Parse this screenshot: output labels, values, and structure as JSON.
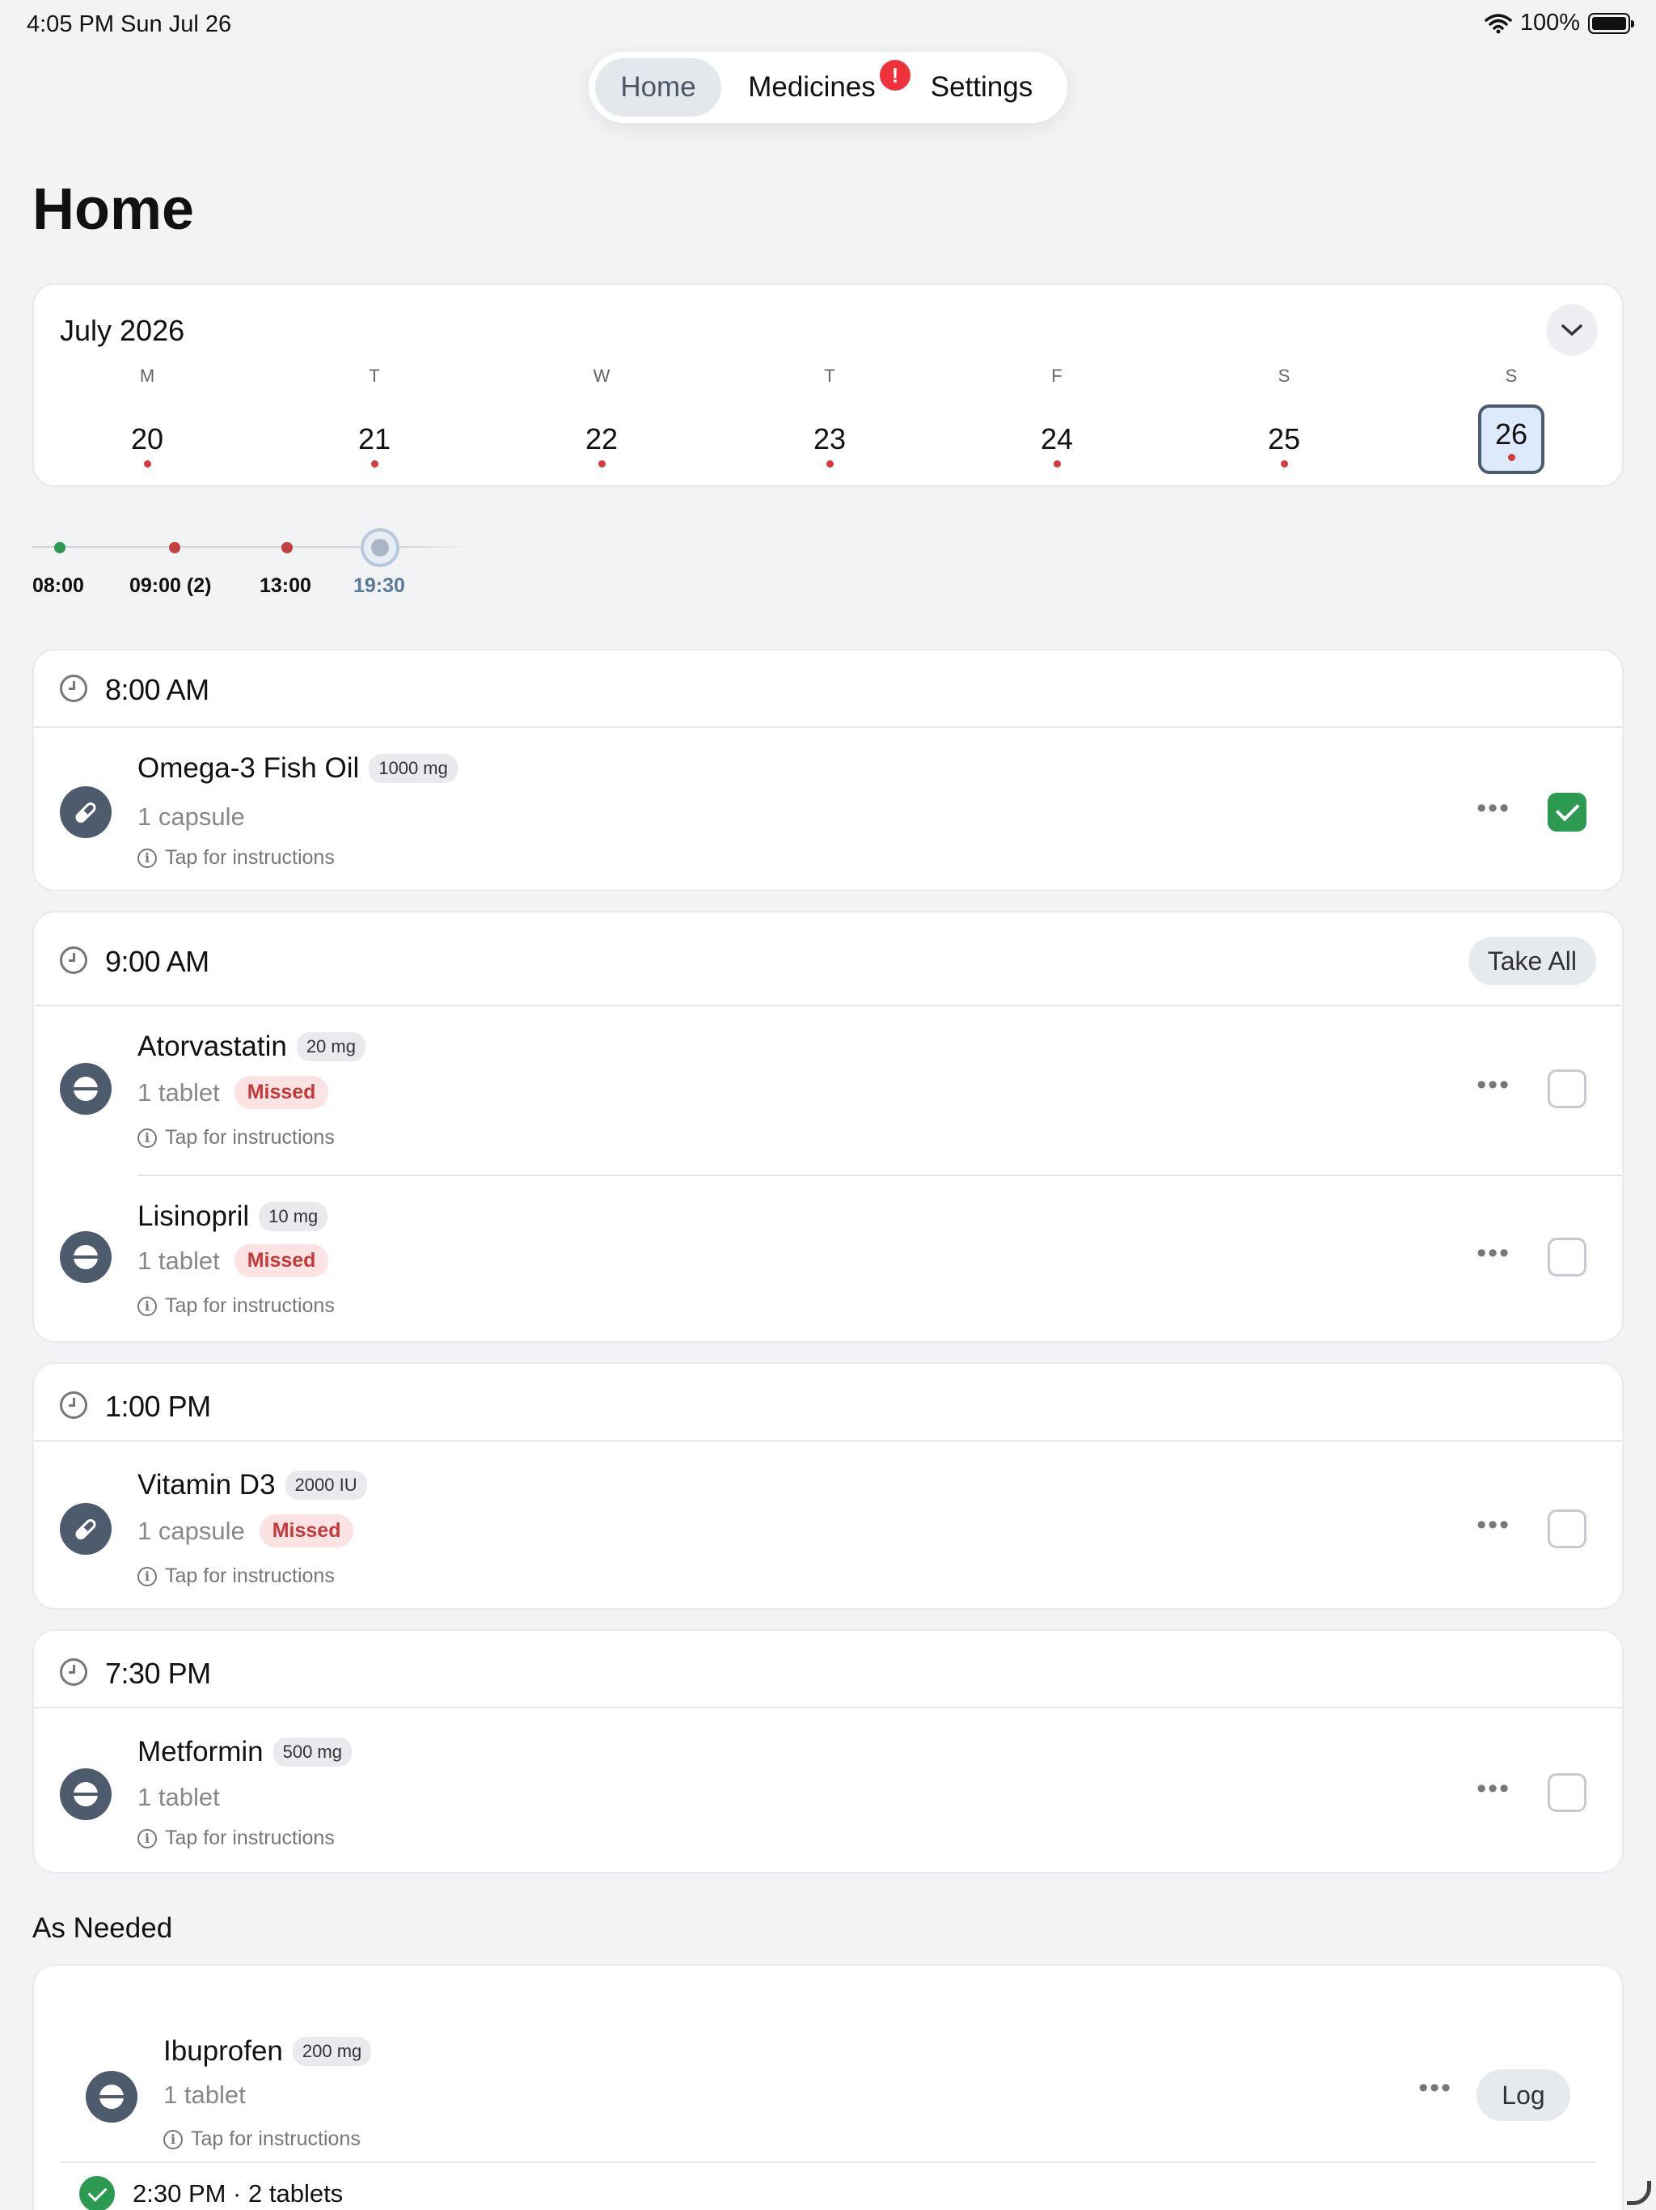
{
  "status_bar": {
    "time_date": "4:05 PM   Sun Jul 26",
    "battery": "100%"
  },
  "nav": {
    "tabs": [
      "Home",
      "Medicines",
      "Settings"
    ],
    "medicines_badge": "!"
  },
  "page_title": "Home",
  "calendar": {
    "month": "July 2026",
    "days": [
      {
        "dow": "M",
        "date": "20"
      },
      {
        "dow": "T",
        "date": "21"
      },
      {
        "dow": "W",
        "date": "22"
      },
      {
        "dow": "T",
        "date": "23"
      },
      {
        "dow": "F",
        "date": "24"
      },
      {
        "dow": "S",
        "date": "25"
      },
      {
        "dow": "S",
        "date": "26",
        "selected": true
      }
    ]
  },
  "timeline": [
    "08:00",
    "09:00 (2)",
    "13:00",
    "19:30"
  ],
  "groups": [
    {
      "time": "8:00 AM",
      "meds": [
        {
          "name": "Omega-3 Fish Oil",
          "strength": "1000 mg",
          "dose": "1 capsule",
          "instructions": "Tap for instructions",
          "form": "capsule",
          "taken": true
        }
      ]
    },
    {
      "time": "9:00 AM",
      "action": "Take All",
      "meds": [
        {
          "name": "Atorvastatin",
          "strength": "20 mg",
          "dose": "1 tablet",
          "status": "Missed",
          "instructions": "Tap for instructions",
          "form": "tablet"
        },
        {
          "name": "Lisinopril",
          "strength": "10 mg",
          "dose": "1 tablet",
          "status": "Missed",
          "instructions": "Tap for instructions",
          "form": "tablet"
        }
      ]
    },
    {
      "time": "1:00 PM",
      "meds": [
        {
          "name": "Vitamin D3",
          "strength": "2000 IU",
          "dose": "1 capsule",
          "status": "Missed",
          "instructions": "Tap for instructions",
          "form": "capsule"
        }
      ]
    },
    {
      "time": "7:30 PM",
      "meds": [
        {
          "name": "Metformin",
          "strength": "500 mg",
          "dose": "1 tablet",
          "instructions": "Tap for instructions",
          "form": "tablet"
        }
      ]
    }
  ],
  "as_needed": {
    "title": "As Needed",
    "med": {
      "name": "Ibuprofen",
      "strength": "200 mg",
      "dose": "1 tablet",
      "instructions": "Tap for instructions",
      "form": "tablet"
    },
    "log_label": "Log",
    "log_entry": "2:30 PM · 2 tablets"
  },
  "more_glyph": "•••",
  "info_glyph": "i"
}
